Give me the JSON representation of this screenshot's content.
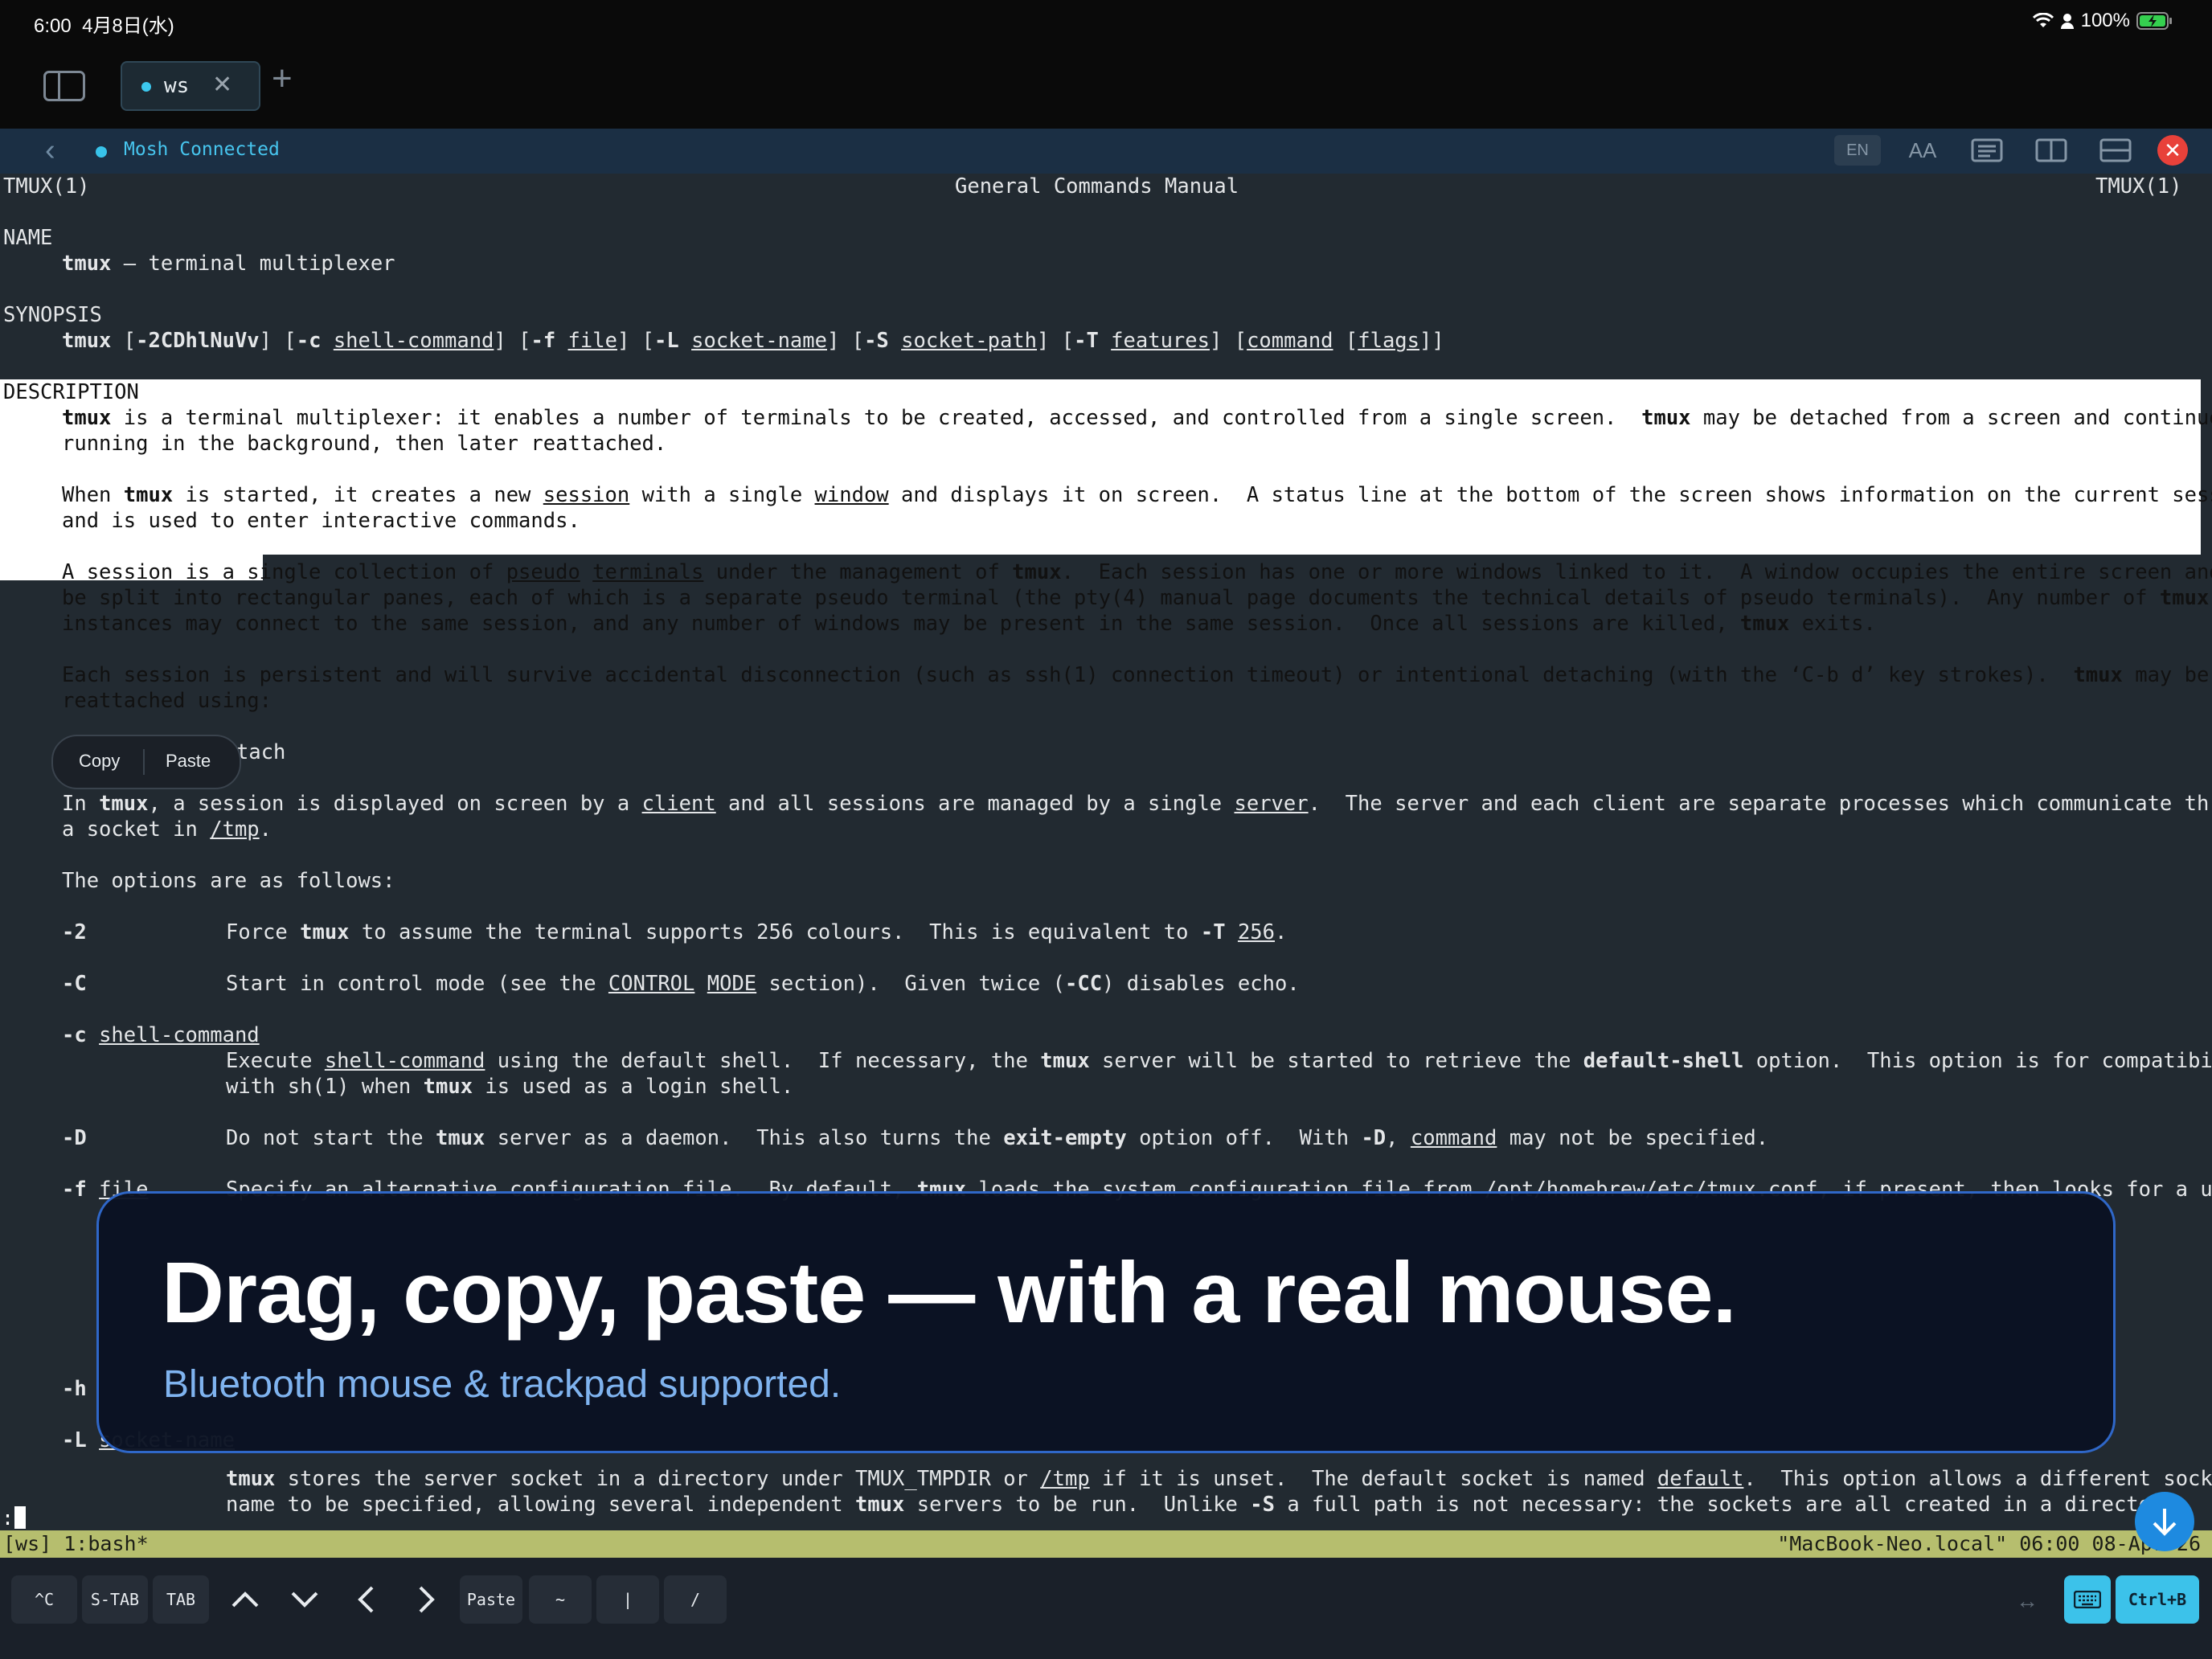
{
  "status": {
    "time": "6:00",
    "date": "4月8日(水)",
    "battery": "100%"
  },
  "tabbar": {
    "tab_label": "ws",
    "close_glyph": "✕",
    "add_glyph": "+"
  },
  "connection": {
    "status_text": "Mosh Connected",
    "lang_label": "EN",
    "font_label": "AA"
  },
  "manpage": {
    "header_left": "TMUX(1)",
    "header_center": "General Commands Manual",
    "header_right": "TMUX(1)",
    "name_heading": "NAME",
    "name_cmd": "tmux",
    "name_desc": " – terminal multiplexer",
    "synopsis_heading": "SYNOPSIS",
    "synopsis": {
      "t1": "tmux",
      "t2": " [",
      "t3": "-2CDhlNuVv",
      "t4": "] [",
      "t5": "-c",
      "t6": " ",
      "t7": "shell-command",
      "t8": "] [",
      "t9": "-f",
      "t10": " ",
      "t11": "file",
      "t12": "] [",
      "t13": "-L",
      "t14": " ",
      "t15": "socket-name",
      "t16": "] [",
      "t17": "-S",
      "t18": " ",
      "t19": "socket-path",
      "t20": "] [",
      "t21": "-T",
      "t22": " ",
      "t23": "features",
      "t24": "] [",
      "t25": "command",
      "t26": " [",
      "t27": "flags",
      "t28": "]]"
    },
    "description_heading": "DESCRIPTION",
    "desc": {
      "p1a": "tmux",
      "p1b": " is a terminal multiplexer: it enables a number of terminals to be created, accessed, and controlled from a single screen.  ",
      "p1c": "tmux",
      "p1d": " may be detached from a screen and continue",
      "p1e": "running in the background, then later reattached.",
      "p2a": "When ",
      "p2b": "tmux",
      "p2c": " is started, it creates a new ",
      "p2d": "session",
      "p2e": " with a single ",
      "p2f": "window",
      "p2g": " and displays it on screen.  A status line at the bottom of the screen shows information on the current session",
      "p2h": "and is used to enter interactive commands.",
      "p3a": "A session is a single collection of ",
      "p3b": "pseudo",
      "p3c": " ",
      "p3d": "terminals",
      "p3e": " under the management of ",
      "p3f": "tmux",
      "p3g": ".  Each session has one or more windows linked to it.  A window occupies the entire screen and may",
      "p3h": "be split into rectangular panes, each of which is a separate pseudo terminal (the pty(4) manual page documents the technical details of pseudo terminals).  Any number of ",
      "p3i": "tmux",
      "p3j": "instances may connect to the same session, and any number of windows may be present in the same session.  Once all sessions are killed, ",
      "p3k": "tmux",
      "p3l": " exits.",
      "p4a": "Each session is persistent and will survive accidental disconnection (such as ssh(1) connection timeout) or intentional detaching (with the ‘C-b d’ key strokes).  ",
      "p4b": "tmux",
      "p4c": " may be",
      "p4d": "reattached using:",
      "p5": "tach",
      "p6a": "In ",
      "p6b": "tmux",
      "p6c": ", a session is displayed on screen by a ",
      "p6d": "client",
      "p6e": " and all sessions are managed by a single ",
      "p6f": "server",
      "p6g": ".  The server and each client are separate processes which communicate through",
      "p6h": "a socket in ",
      "p6i": "/tmp",
      "p6j": ".",
      "p7": "The options are as follows:"
    },
    "options": {
      "o2_flag": "-2",
      "o2a": "Force ",
      "o2b": "tmux",
      "o2c": " to assume the terminal supports 256 colours.  This is equivalent to ",
      "o2d": "-T",
      "o2e": " ",
      "o2f": "256",
      "o2g": ".",
      "oC_flag": "-C",
      "oCa": "Start in control mode (see the ",
      "oCb": "CONTROL",
      "oCc": " ",
      "oCd": "MODE",
      "oCe": " section).  Given twice (",
      "oCf": "-CC",
      "oCg": ") disables echo.",
      "oc_flag": "-c",
      "oc_arg": "shell-command",
      "oca": "Execute ",
      "ocb": "shell-command",
      "occ": " using the default shell.  If necessary, the ",
      "ocd": "tmux",
      "oce": " server will be started to retrieve the ",
      "ocf": "default-shell",
      "ocg": " option.  This option is for compatibility",
      "och": "with sh(1) when ",
      "oci": "tmux",
      "ocj": " is used as a login shell.",
      "oD_flag": "-D",
      "oDa": "Do not start the ",
      "oDb": "tmux",
      "oDc": " server as a daemon.  This also turns the ",
      "oDd": "exit-empty",
      "oDe": " option off.  With ",
      "oDf": "-D",
      "oDg": ", ",
      "oDh": "command",
      "oDi": " may not be specified.",
      "of_flag": "-f",
      "of_arg": "file",
      "ofa": "Specify an alternative configuration file.  By default, ",
      "ofb": "tmux",
      "ofc": " loads the system configuration file from /opt/homebrew/etc/tmux.conf, if present, then looks for a user",
      "oh_flag": "-h",
      "oL_flag": "-L",
      "oL_arg": "socket-name",
      "oLa": "tmux",
      "oLb": " stores the server socket in a directory under TMUX_TMPDIR or ",
      "oLc": "/tmp",
      "oLd": " if it is unset.  The default socket is named ",
      "oLe": "default",
      "oLf": ".  This option allows a different socket",
      "oLg": "name to be specified, allowing several independent ",
      "oLh": "tmux",
      "oLi": " servers to be run.  Unlike ",
      "oLj": "-S",
      "oLk": " a full path is not necessary: the sockets are all created in a directory"
    }
  },
  "context_menu": {
    "copy": "Copy",
    "paste": "Paste"
  },
  "tmux_status": {
    "left": "[ws] 1:bash*",
    "right": "\"MacBook-Neo.local\" 06:00 08-Apr-26"
  },
  "command_line": {
    "prompt": ":"
  },
  "keys": {
    "ctrl_c": "^C",
    "s_tab": "S-TAB",
    "tab": "TAB",
    "paste": "Paste",
    "tilde": "~",
    "pipe": "|",
    "slash": "/",
    "ctrl_b": "Ctrl+B"
  },
  "promo": {
    "headline": "Drag, copy, paste — with a real mouse.",
    "subtitle": "Bluetooth mouse & trackpad supported."
  },
  "colors": {
    "accent": "#3cc2ea",
    "tmux_bar": "#b6be6e",
    "promo_border": "#2f67c8"
  }
}
